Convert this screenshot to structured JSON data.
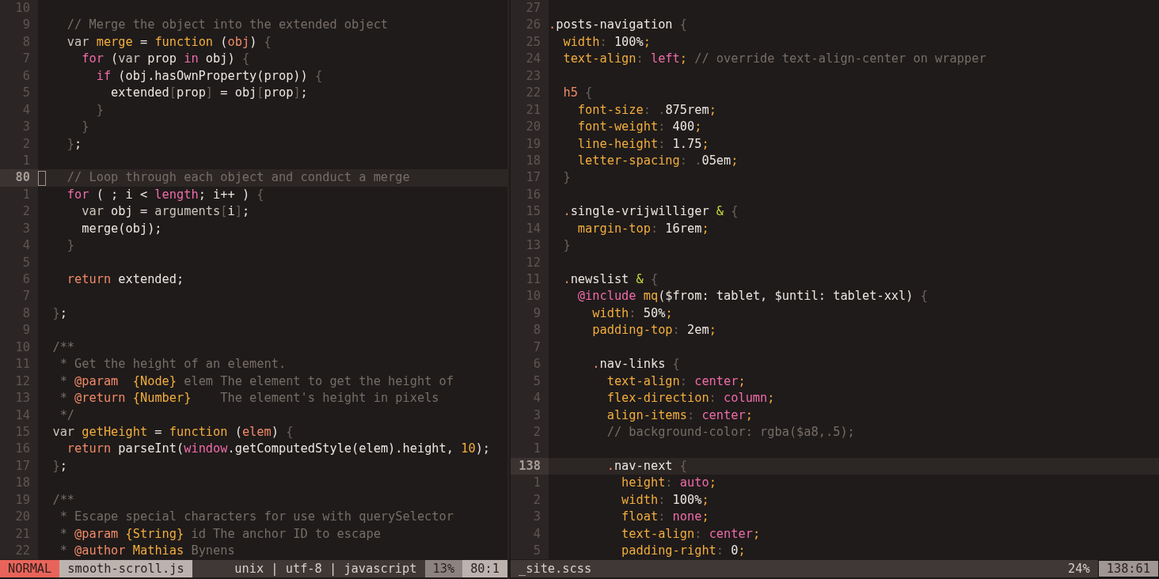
{
  "panes": [
    {
      "focused": true,
      "lines": [
        {
          "number": "10",
          "current": false
        },
        {
          "number": "9",
          "current": false,
          "tokens": [
            {
              "kind": "comment",
              "text": "    // Merge the object into the extended object"
            }
          ]
        },
        {
          "number": "8",
          "current": false,
          "tokens": [
            {
              "kind": "storage",
              "text": "    var "
            },
            {
              "kind": "func",
              "text": "merge"
            },
            {
              "kind": "plain",
              "text": " = "
            },
            {
              "kind": "func",
              "text": "function"
            },
            {
              "kind": "plain",
              "text": " ("
            },
            {
              "kind": "param",
              "text": "obj"
            },
            {
              "kind": "plain",
              "text": ") "
            },
            {
              "kind": "punct",
              "text": "{"
            }
          ]
        },
        {
          "number": "7",
          "current": false,
          "tokens": [
            {
              "kind": "keyword",
              "text": "      for"
            },
            {
              "kind": "plain",
              "text": " ("
            },
            {
              "kind": "storage",
              "text": "var"
            },
            {
              "kind": "plain",
              "text": " prop "
            },
            {
              "kind": "keyword",
              "text": "in"
            },
            {
              "kind": "plain",
              "text": " obj) "
            },
            {
              "kind": "punct",
              "text": "{"
            }
          ]
        },
        {
          "number": "6",
          "current": false,
          "tokens": [
            {
              "kind": "keyword",
              "text": "        if"
            },
            {
              "kind": "plain",
              "text": " (obj.hasOwnProperty(prop)) "
            },
            {
              "kind": "punct",
              "text": "{"
            }
          ]
        },
        {
          "number": "5",
          "current": false,
          "tokens": [
            {
              "kind": "plain",
              "text": "          extended"
            },
            {
              "kind": "punct",
              "text": "["
            },
            {
              "kind": "plain",
              "text": "prop"
            },
            {
              "kind": "punct",
              "text": "]"
            },
            {
              "kind": "plain",
              "text": " = obj"
            },
            {
              "kind": "punct",
              "text": "["
            },
            {
              "kind": "plain",
              "text": "prop"
            },
            {
              "kind": "punct",
              "text": "]"
            },
            {
              "kind": "plain",
              "text": ";"
            }
          ]
        },
        {
          "number": "4",
          "current": false,
          "tokens": [
            {
              "kind": "punct",
              "text": "        }"
            }
          ]
        },
        {
          "number": "3",
          "current": false,
          "tokens": [
            {
              "kind": "punct",
              "text": "      }"
            }
          ]
        },
        {
          "number": "2",
          "current": false,
          "tokens": [
            {
              "kind": "punct",
              "text": "    }"
            },
            {
              "kind": "plain",
              "text": ";"
            }
          ]
        },
        {
          "number": "1",
          "current": false
        },
        {
          "number": "80",
          "current": true,
          "tokens": [
            {
              "kind": "comment",
              "text": "    // Loop through each object and conduct a merge"
            }
          ]
        },
        {
          "number": "1",
          "current": false,
          "tokens": [
            {
              "kind": "keyword",
              "text": "    for"
            },
            {
              "kind": "plain",
              "text": " ( ; i < "
            },
            {
              "kind": "keyword",
              "text": "length"
            },
            {
              "kind": "plain",
              "text": "; i++ ) "
            },
            {
              "kind": "punct",
              "text": "{"
            }
          ]
        },
        {
          "number": "2",
          "current": false,
          "tokens": [
            {
              "kind": "storage",
              "text": "      var"
            },
            {
              "kind": "plain",
              "text": " obj = "
            },
            {
              "kind": "storage",
              "text": "arguments"
            },
            {
              "kind": "punct",
              "text": "["
            },
            {
              "kind": "plain",
              "text": "i"
            },
            {
              "kind": "punct",
              "text": "]"
            },
            {
              "kind": "plain",
              "text": ";"
            }
          ]
        },
        {
          "number": "3",
          "current": false,
          "tokens": [
            {
              "kind": "plain",
              "text": "      merge(obj);"
            }
          ]
        },
        {
          "number": "4",
          "current": false,
          "tokens": [
            {
              "kind": "punct",
              "text": "    }"
            }
          ]
        },
        {
          "number": "5",
          "current": false
        },
        {
          "number": "6",
          "current": false,
          "tokens": [
            {
              "kind": "param",
              "text": "    return"
            },
            {
              "kind": "plain",
              "text": " extended;"
            }
          ]
        },
        {
          "number": "7",
          "current": false
        },
        {
          "number": "8",
          "current": false,
          "tokens": [
            {
              "kind": "punct",
              "text": "  }"
            },
            {
              "kind": "plain",
              "text": ";"
            }
          ]
        },
        {
          "number": "9",
          "current": false
        },
        {
          "number": "10",
          "current": false,
          "tokens": [
            {
              "kind": "comment",
              "text": "  /**"
            }
          ]
        },
        {
          "number": "11",
          "current": false,
          "tokens": [
            {
              "kind": "comment",
              "text": "   * Get the height of an element."
            }
          ]
        },
        {
          "number": "12",
          "current": false,
          "tokens": [
            {
              "kind": "comment",
              "text": "   * "
            },
            {
              "kind": "param",
              "text": "@param  "
            },
            {
              "kind": "func",
              "text": "{Node}"
            },
            {
              "kind": "comment",
              "text": " elem The element to get the height of"
            }
          ]
        },
        {
          "number": "13",
          "current": false,
          "tokens": [
            {
              "kind": "comment",
              "text": "   * "
            },
            {
              "kind": "param",
              "text": "@return "
            },
            {
              "kind": "func",
              "text": "{Number}"
            },
            {
              "kind": "comment",
              "text": "    The element's height in pixels"
            }
          ]
        },
        {
          "number": "14",
          "current": false,
          "tokens": [
            {
              "kind": "comment",
              "text": "   */"
            }
          ]
        },
        {
          "number": "15",
          "current": false,
          "tokens": [
            {
              "kind": "storage",
              "text": "  var "
            },
            {
              "kind": "func",
              "text": "getHeight"
            },
            {
              "kind": "plain",
              "text": " = "
            },
            {
              "kind": "func",
              "text": "function"
            },
            {
              "kind": "plain",
              "text": " ("
            },
            {
              "kind": "param",
              "text": "elem"
            },
            {
              "kind": "plain",
              "text": ") "
            },
            {
              "kind": "punct",
              "text": "{"
            }
          ]
        },
        {
          "number": "16",
          "current": false,
          "tokens": [
            {
              "kind": "param",
              "text": "    return"
            },
            {
              "kind": "plain",
              "text": " parseInt("
            },
            {
              "kind": "keyword",
              "text": "window"
            },
            {
              "kind": "plain",
              "text": ".getComputedStyle(elem).height, "
            },
            {
              "kind": "func",
              "text": "10"
            },
            {
              "kind": "plain",
              "text": ");"
            }
          ]
        },
        {
          "number": "17",
          "current": false,
          "tokens": [
            {
              "kind": "punct",
              "text": "  }"
            },
            {
              "kind": "plain",
              "text": ";"
            }
          ]
        },
        {
          "number": "18",
          "current": false
        },
        {
          "number": "19",
          "current": false,
          "tokens": [
            {
              "kind": "comment",
              "text": "  /**"
            }
          ]
        },
        {
          "number": "20",
          "current": false,
          "tokens": [
            {
              "kind": "comment",
              "text": "   * Escape special characters for use with querySelector"
            }
          ]
        },
        {
          "number": "21",
          "current": false,
          "tokens": [
            {
              "kind": "comment",
              "text": "   * "
            },
            {
              "kind": "param",
              "text": "@param "
            },
            {
              "kind": "func",
              "text": "{String}"
            },
            {
              "kind": "comment",
              "text": " id The anchor ID to escape"
            }
          ]
        },
        {
          "number": "22",
          "current": false,
          "tokens": [
            {
              "kind": "comment",
              "text": "   * "
            },
            {
              "kind": "param",
              "text": "@author "
            },
            {
              "kind": "func",
              "text": "Mathias"
            },
            {
              "kind": "comment",
              "text": " Bynens"
            }
          ]
        }
      ],
      "status": [
        {
          "kind": "mode",
          "text": "NORMAL"
        },
        {
          "kind": "light",
          "text": "smooth-scroll.js"
        },
        {
          "kind": "fill",
          "text": "unix | utf-8 | javascript"
        },
        {
          "kind": "mid",
          "text": "13%"
        },
        {
          "kind": "light",
          "text": "80:1"
        }
      ]
    },
    {
      "focused": false,
      "lines": [
        {
          "number": "27",
          "current": false
        },
        {
          "number": "26",
          "current": false,
          "tokens": [
            {
              "kind": "param",
              "text": "."
            },
            {
              "kind": "plain",
              "text": "posts-navigation "
            },
            {
              "kind": "punct",
              "text": "{"
            }
          ]
        },
        {
          "number": "25",
          "current": false,
          "tokens": [
            {
              "kind": "func",
              "text": "  width"
            },
            {
              "kind": "punct",
              "text": ":"
            },
            {
              "kind": "plain",
              "text": " 100%"
            },
            {
              "kind": "func",
              "text": ";"
            }
          ]
        },
        {
          "number": "24",
          "current": false,
          "tokens": [
            {
              "kind": "func",
              "text": "  text-align"
            },
            {
              "kind": "punct",
              "text": ": "
            },
            {
              "kind": "keyword",
              "text": "left"
            },
            {
              "kind": "func",
              "text": ";"
            },
            {
              "kind": "comment",
              "text": " // override text-align-center on wrapper"
            }
          ]
        },
        {
          "number": "23",
          "current": false
        },
        {
          "number": "22",
          "current": false,
          "tokens": [
            {
              "kind": "param",
              "text": "  h5 "
            },
            {
              "kind": "punct",
              "text": "{"
            }
          ]
        },
        {
          "number": "21",
          "current": false,
          "tokens": [
            {
              "kind": "func",
              "text": "    font-size"
            },
            {
              "kind": "punct",
              "text": ": ."
            },
            {
              "kind": "plain",
              "text": "875rem"
            },
            {
              "kind": "func",
              "text": ";"
            }
          ]
        },
        {
          "number": "20",
          "current": false,
          "tokens": [
            {
              "kind": "func",
              "text": "    font-weight"
            },
            {
              "kind": "punct",
              "text": ":"
            },
            {
              "kind": "plain",
              "text": " 400"
            },
            {
              "kind": "func",
              "text": ";"
            }
          ]
        },
        {
          "number": "19",
          "current": false,
          "tokens": [
            {
              "kind": "func",
              "text": "    line-height"
            },
            {
              "kind": "punct",
              "text": ":"
            },
            {
              "kind": "plain",
              "text": " 1.75"
            },
            {
              "kind": "func",
              "text": ";"
            }
          ]
        },
        {
          "number": "18",
          "current": false,
          "tokens": [
            {
              "kind": "func",
              "text": "    letter-spacing"
            },
            {
              "kind": "punct",
              "text": ": ."
            },
            {
              "kind": "plain",
              "text": "05em"
            },
            {
              "kind": "func",
              "text": ";"
            }
          ]
        },
        {
          "number": "17",
          "current": false,
          "tokens": [
            {
              "kind": "punct",
              "text": "  }"
            }
          ]
        },
        {
          "number": "16",
          "current": false
        },
        {
          "number": "15",
          "current": false,
          "tokens": [
            {
              "kind": "param",
              "text": "  ."
            },
            {
              "kind": "plain",
              "text": "single-vrijwilliger "
            },
            {
              "kind": "amp",
              "text": "& "
            },
            {
              "kind": "punct",
              "text": "{"
            }
          ]
        },
        {
          "number": "14",
          "current": false,
          "tokens": [
            {
              "kind": "func",
              "text": "    margin-top"
            },
            {
              "kind": "punct",
              "text": ":"
            },
            {
              "kind": "plain",
              "text": " 16rem"
            },
            {
              "kind": "func",
              "text": ";"
            }
          ]
        },
        {
          "number": "13",
          "current": false,
          "tokens": [
            {
              "kind": "punct",
              "text": "  }"
            }
          ]
        },
        {
          "number": "12",
          "current": false
        },
        {
          "number": "11",
          "current": false,
          "tokens": [
            {
              "kind": "param",
              "text": "  ."
            },
            {
              "kind": "plain",
              "text": "newslist "
            },
            {
              "kind": "amp",
              "text": "& "
            },
            {
              "kind": "punct",
              "text": "{"
            }
          ]
        },
        {
          "number": "10",
          "current": false,
          "tokens": [
            {
              "kind": "keyword",
              "text": "    @include "
            },
            {
              "kind": "func",
              "text": "mq"
            },
            {
              "kind": "plain",
              "text": "($from: tablet, $until: tablet-xxl) "
            },
            {
              "kind": "punct",
              "text": "{"
            }
          ]
        },
        {
          "number": "9",
          "current": false,
          "tokens": [
            {
              "kind": "func",
              "text": "      width"
            },
            {
              "kind": "punct",
              "text": ":"
            },
            {
              "kind": "plain",
              "text": " 50%"
            },
            {
              "kind": "func",
              "text": ";"
            }
          ]
        },
        {
          "number": "8",
          "current": false,
          "tokens": [
            {
              "kind": "func",
              "text": "      padding-top"
            },
            {
              "kind": "punct",
              "text": ":"
            },
            {
              "kind": "plain",
              "text": " 2em"
            },
            {
              "kind": "func",
              "text": ";"
            }
          ]
        },
        {
          "number": "7",
          "current": false
        },
        {
          "number": "6",
          "current": false,
          "tokens": [
            {
              "kind": "param",
              "text": "      ."
            },
            {
              "kind": "plain",
              "text": "nav-links "
            },
            {
              "kind": "punct",
              "text": "{"
            }
          ]
        },
        {
          "number": "5",
          "current": false,
          "tokens": [
            {
              "kind": "func",
              "text": "        text-align"
            },
            {
              "kind": "punct",
              "text": ": "
            },
            {
              "kind": "keyword",
              "text": "center"
            },
            {
              "kind": "func",
              "text": ";"
            }
          ]
        },
        {
          "number": "4",
          "current": false,
          "tokens": [
            {
              "kind": "func",
              "text": "        flex-direction"
            },
            {
              "kind": "punct",
              "text": ": "
            },
            {
              "kind": "keyword",
              "text": "column"
            },
            {
              "kind": "func",
              "text": ";"
            }
          ]
        },
        {
          "number": "3",
          "current": false,
          "tokens": [
            {
              "kind": "func",
              "text": "        align-items"
            },
            {
              "kind": "punct",
              "text": ": "
            },
            {
              "kind": "keyword",
              "text": "center"
            },
            {
              "kind": "func",
              "text": ";"
            }
          ]
        },
        {
          "number": "2",
          "current": false,
          "tokens": [
            {
              "kind": "comment",
              "text": "        // background-color: rgba($a8,.5);"
            }
          ]
        },
        {
          "number": "1",
          "current": false
        },
        {
          "number": "138",
          "current": true,
          "tokens": [
            {
              "kind": "param",
              "text": "        ."
            },
            {
              "kind": "plain",
              "text": "nav-next "
            },
            {
              "kind": "punct",
              "text": "{"
            }
          ]
        },
        {
          "number": "1",
          "current": false,
          "tokens": [
            {
              "kind": "func",
              "text": "          height"
            },
            {
              "kind": "punct",
              "text": ": "
            },
            {
              "kind": "keyword",
              "text": "auto"
            },
            {
              "kind": "func",
              "text": ";"
            }
          ]
        },
        {
          "number": "2",
          "current": false,
          "tokens": [
            {
              "kind": "func",
              "text": "          width"
            },
            {
              "kind": "punct",
              "text": ":"
            },
            {
              "kind": "plain",
              "text": " 100%"
            },
            {
              "kind": "func",
              "text": ";"
            }
          ]
        },
        {
          "number": "3",
          "current": false,
          "tokens": [
            {
              "kind": "func",
              "text": "          float"
            },
            {
              "kind": "punct",
              "text": ": "
            },
            {
              "kind": "keyword",
              "text": "none"
            },
            {
              "kind": "func",
              "text": ";"
            }
          ]
        },
        {
          "number": "4",
          "current": false,
          "tokens": [
            {
              "kind": "func",
              "text": "          text-align"
            },
            {
              "kind": "punct",
              "text": ": "
            },
            {
              "kind": "keyword",
              "text": "center"
            },
            {
              "kind": "func",
              "text": ";"
            }
          ]
        },
        {
          "number": "5",
          "current": false,
          "tokens": [
            {
              "kind": "func",
              "text": "          padding-right"
            },
            {
              "kind": "punct",
              "text": ":"
            },
            {
              "kind": "plain",
              "text": " 0"
            },
            {
              "kind": "func",
              "text": ";"
            }
          ]
        }
      ],
      "status": [
        {
          "kind": "plain",
          "text": "_site.scss"
        },
        {
          "kind": "fill",
          "text": "24%"
        },
        {
          "kind": "framed",
          "text": "138:61"
        }
      ]
    }
  ]
}
